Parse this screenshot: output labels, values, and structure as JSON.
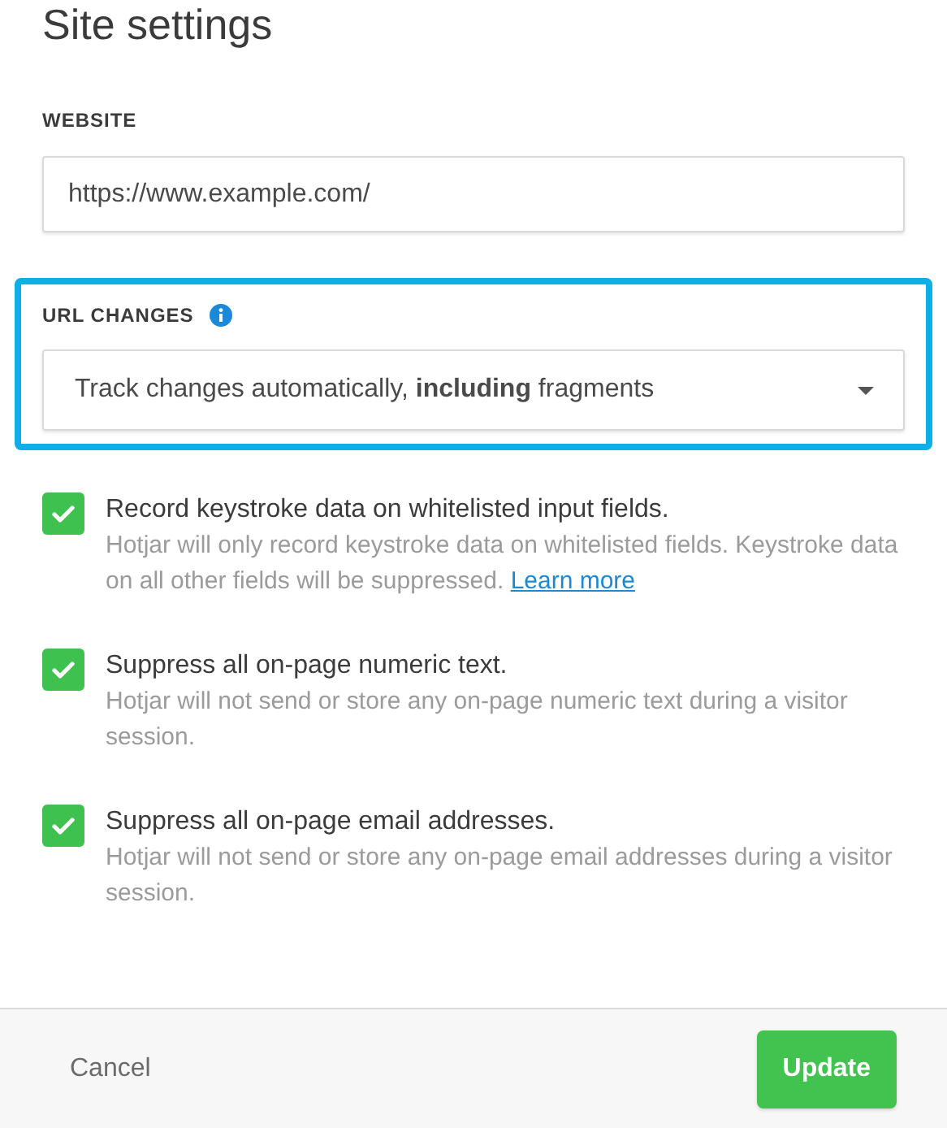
{
  "title": "Site settings",
  "website": {
    "label": "WEBSITE",
    "value": "https://www.example.com/"
  },
  "url_changes": {
    "label": "URL CHANGES",
    "highlighted": true,
    "value": "Track changes automatically, **including** fragments"
  },
  "options": [
    {
      "checked": true,
      "label": "Record keystroke data on whitelisted input fields.",
      "description": "Hotjar will only record keystroke data on whitelisted fields. Keystroke data on all other fields will be suppressed.",
      "link": "Learn more"
    },
    {
      "checked": true,
      "label": "Suppress all on-page numeric text.",
      "description": "Hotjar will not send or store any on-page numeric text during a visitor session."
    },
    {
      "checked": true,
      "label": "Suppress all on-page email addresses.",
      "description": "Hotjar will not send or store any on-page email addresses during a visitor session."
    }
  ],
  "footer": {
    "cancel": "Cancel",
    "submit": "Update"
  }
}
